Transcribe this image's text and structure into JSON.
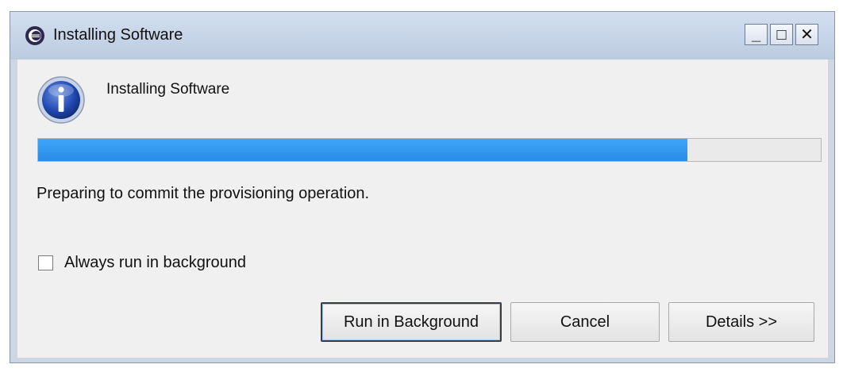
{
  "window": {
    "title": "Installing Software",
    "controls": {
      "minimize": "_",
      "maximize": "□",
      "close": "✕"
    }
  },
  "dialog": {
    "heading": "Installing Software",
    "icon": "info-icon",
    "progress_percent": 83,
    "status": "Preparing to commit the provisioning operation.",
    "checkbox": {
      "label": "Always run in background",
      "checked": false
    },
    "buttons": {
      "run_in_background": "Run in Background",
      "cancel": "Cancel",
      "details": "Details >>"
    }
  },
  "colors": {
    "progress": "#2a8be9",
    "titlebar": "#c8d5e8"
  }
}
